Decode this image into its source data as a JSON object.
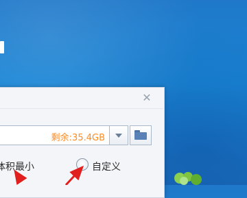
{
  "dialog": {
    "close_glyph": "✕",
    "path_field": {
      "free_space": "剩余:35.4GB"
    },
    "options": {
      "left_label": "体积最小",
      "right_label": "自定义"
    }
  },
  "colors": {
    "desktop": "#1a86d6",
    "free_space_text": "#ff8a1e",
    "arrow": "#e11f1f"
  },
  "icons": [
    "close-icon",
    "chevron-down-icon",
    "folder-icon",
    "radio-icon",
    "plant-icon"
  ]
}
